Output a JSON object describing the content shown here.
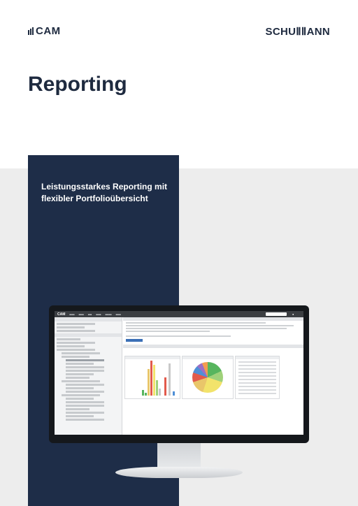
{
  "header": {
    "cam_logo": "CAM",
    "schumann_logo": "SCHUⅡⅡANN"
  },
  "page_title": "Reporting",
  "subtitle": "Leistungsstarkes Reporting mit flexibler Portfolioübersicht",
  "colors": {
    "navy": "#1e2d48",
    "background_grey": "#ededed",
    "text": "#1e2a3f"
  },
  "monitor": {
    "app_logo": "CAM"
  }
}
